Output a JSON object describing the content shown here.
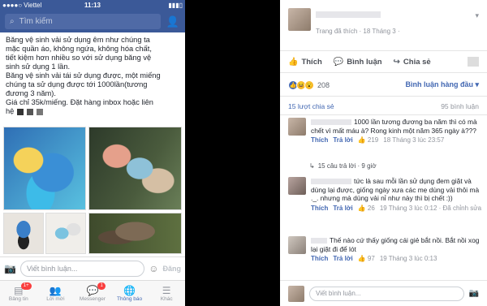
{
  "left": {
    "status": {
      "carrier": "Viettel",
      "time": "11:13"
    },
    "search_placeholder": "Tìm kiếm",
    "post_lines": [
      "Băng vệ sinh vải sử dụng êm như chúng ta",
      "mặc quần áo, không ngứa, không hóa chất,",
      "tiết kiệm hơn nhiều so với sử dụng băng vệ",
      "sinh sử dụng 1 lần.",
      "Băng vệ sinh vải tái sử dụng được, một miếng",
      "chúng ta sử dụng được tới 1000lần(tương",
      "đương 3 năm).",
      "Giá chỉ 35k/miếng. Đặt hàng inbox hoặc liên",
      "hệ"
    ],
    "composer_placeholder": "Viết bình luận...",
    "composer_send": "Đăng",
    "tabs": [
      {
        "label": "Bảng tin",
        "icon": "news-feed-icon",
        "badge": "1+"
      },
      {
        "label": "Lời mời",
        "icon": "friend-requests-icon",
        "badge": ""
      },
      {
        "label": "Messenger",
        "icon": "messenger-icon",
        "badge": "1"
      },
      {
        "label": "Thông báo",
        "icon": "notifications-icon",
        "badge": ""
      },
      {
        "label": "Khác",
        "icon": "menu-icon",
        "badge": ""
      }
    ]
  },
  "right": {
    "subtitle": "Trang đã thích · 18 Tháng 3 ·",
    "actions": {
      "like": "Thích",
      "comment": "Bình luận",
      "share": "Chia sẻ"
    },
    "reaction_count": "208",
    "sort_label": "Bình luận hàng đầu ▾",
    "shares": "15 lượt chia sẻ",
    "comments_count": "95 bình luận",
    "comments": [
      {
        "text": "1000 lần tương đương ba năm thì có mà chết vì mất máu à? Rong kinh một năm 365 ngày à???",
        "like": "Thích",
        "reply": "Trả lời",
        "likes": "219",
        "time": "18 Tháng 3 lúc 23:57"
      },
      {
        "text": "tức là sau mỗi lần sử dụng đem giặt và dùng lại được, giống ngày xưa các mẹ dùng vải thôi mà ._. nhưng mà dùng vải nỉ như này thì bị chết :))",
        "like": "Thích",
        "reply": "Trả lời",
        "likes": "26",
        "time": "19 Tháng 3 lúc 0:12 · Đã chỉnh sửa"
      },
      {
        "text": "Thế nào cứ thấy giống cái giẻ bắt nồi. Bắt nồi xog lại giặt đi để lót",
        "like": "Thích",
        "reply": "Trả lời",
        "likes": "97",
        "time": "19 Tháng 3 lúc 0:13"
      }
    ],
    "replies_label": "15 câu trả lời · 9 giờ",
    "composer_placeholder": "Viết bình luận..."
  }
}
